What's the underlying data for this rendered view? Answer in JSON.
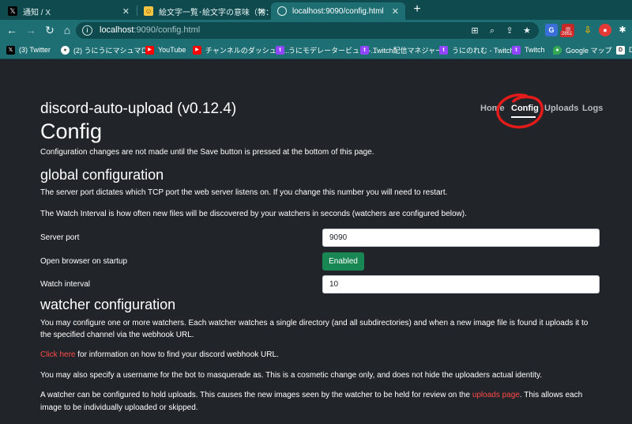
{
  "browser": {
    "tabs": [
      {
        "title": "通知 / X",
        "icon": "x-logo-icon"
      },
      {
        "title": "絵文字一覧･絵文字の意味（物：",
        "icon": "emoji-site-icon"
      },
      {
        "title": "localhost:9090/config.html",
        "icon": "globe-icon"
      }
    ],
    "url_host": "localhost",
    "url_rest": ":9090/config.html",
    "ext_badge": "2851",
    "bookmarks": [
      {
        "label": "(3) Twitter",
        "icon": "x-logo-icon"
      },
      {
        "label": "(2) うにうにマシュマロ...",
        "icon": "marshmallow-icon"
      },
      {
        "label": "YouTube",
        "icon": "youtube-icon"
      },
      {
        "label": "チャンネルのダッシュボ...",
        "icon": "youtube-icon"
      },
      {
        "label": "うにモデレータービュー -...",
        "icon": "twitch-icon"
      },
      {
        "label": "Twitch配信マネジャー",
        "icon": "twitch-icon"
      },
      {
        "label": "うにのれむ - Twitch",
        "icon": "twitch-icon"
      },
      {
        "label": "Twitch",
        "icon": "twitch-icon"
      },
      {
        "label": "Google マップ",
        "icon": "google-maps-icon"
      },
      {
        "label": "De",
        "icon": "bookmark-icon"
      }
    ]
  },
  "header": {
    "brand": "discord-auto-upload (v0.12.4)",
    "nav": {
      "home": "Home",
      "config": "Config",
      "uploads": "Uploads",
      "logs": "Logs"
    }
  },
  "main": {
    "title": "Config",
    "intro": "Configuration changes are not made until the Save button is pressed at the bottom of this page.",
    "global": {
      "heading": "global configuration",
      "p1": "The server port dictates which TCP port the web server listens on. If you change this number you will need to restart.",
      "p2": "The Watch Interval is how often new files will be discovered by your watchers in seconds (watchers are configured below).",
      "server_port_label": "Server port",
      "server_port_value": "9090",
      "open_browser_label": "Open browser on startup",
      "open_browser_button": "Enabled",
      "watch_interval_label": "Watch interval",
      "watch_interval_value": "10"
    },
    "watcher": {
      "heading": "watcher configuration",
      "p1a": "You may configure one or more watchers. Each watcher watches a single directory (and all subdirectories) and when a new image file is found it uploads it to",
      "p1b": "the specified channel via the webhook URL.",
      "click_here": "Click here",
      "p2_rest": " for information on how to find your discord webhook URL.",
      "p3": "You may also specify a username for the bot to masquerade as. This is a cosmetic change only, and does not hide the uploaders actual identity.",
      "p4a": "A watcher can be configured to hold uploads. This causes the new images seen by the watcher to be held for review on the ",
      "uploads_page": "uploads page",
      "p4b": ". This allows each",
      "p4c": "image to be individually uploaded or skipped."
    }
  },
  "colors": {
    "link": "#ff4a4a",
    "enabled_button": "#198754",
    "page_bg": "#212529",
    "chrome": "#1d6f73"
  }
}
